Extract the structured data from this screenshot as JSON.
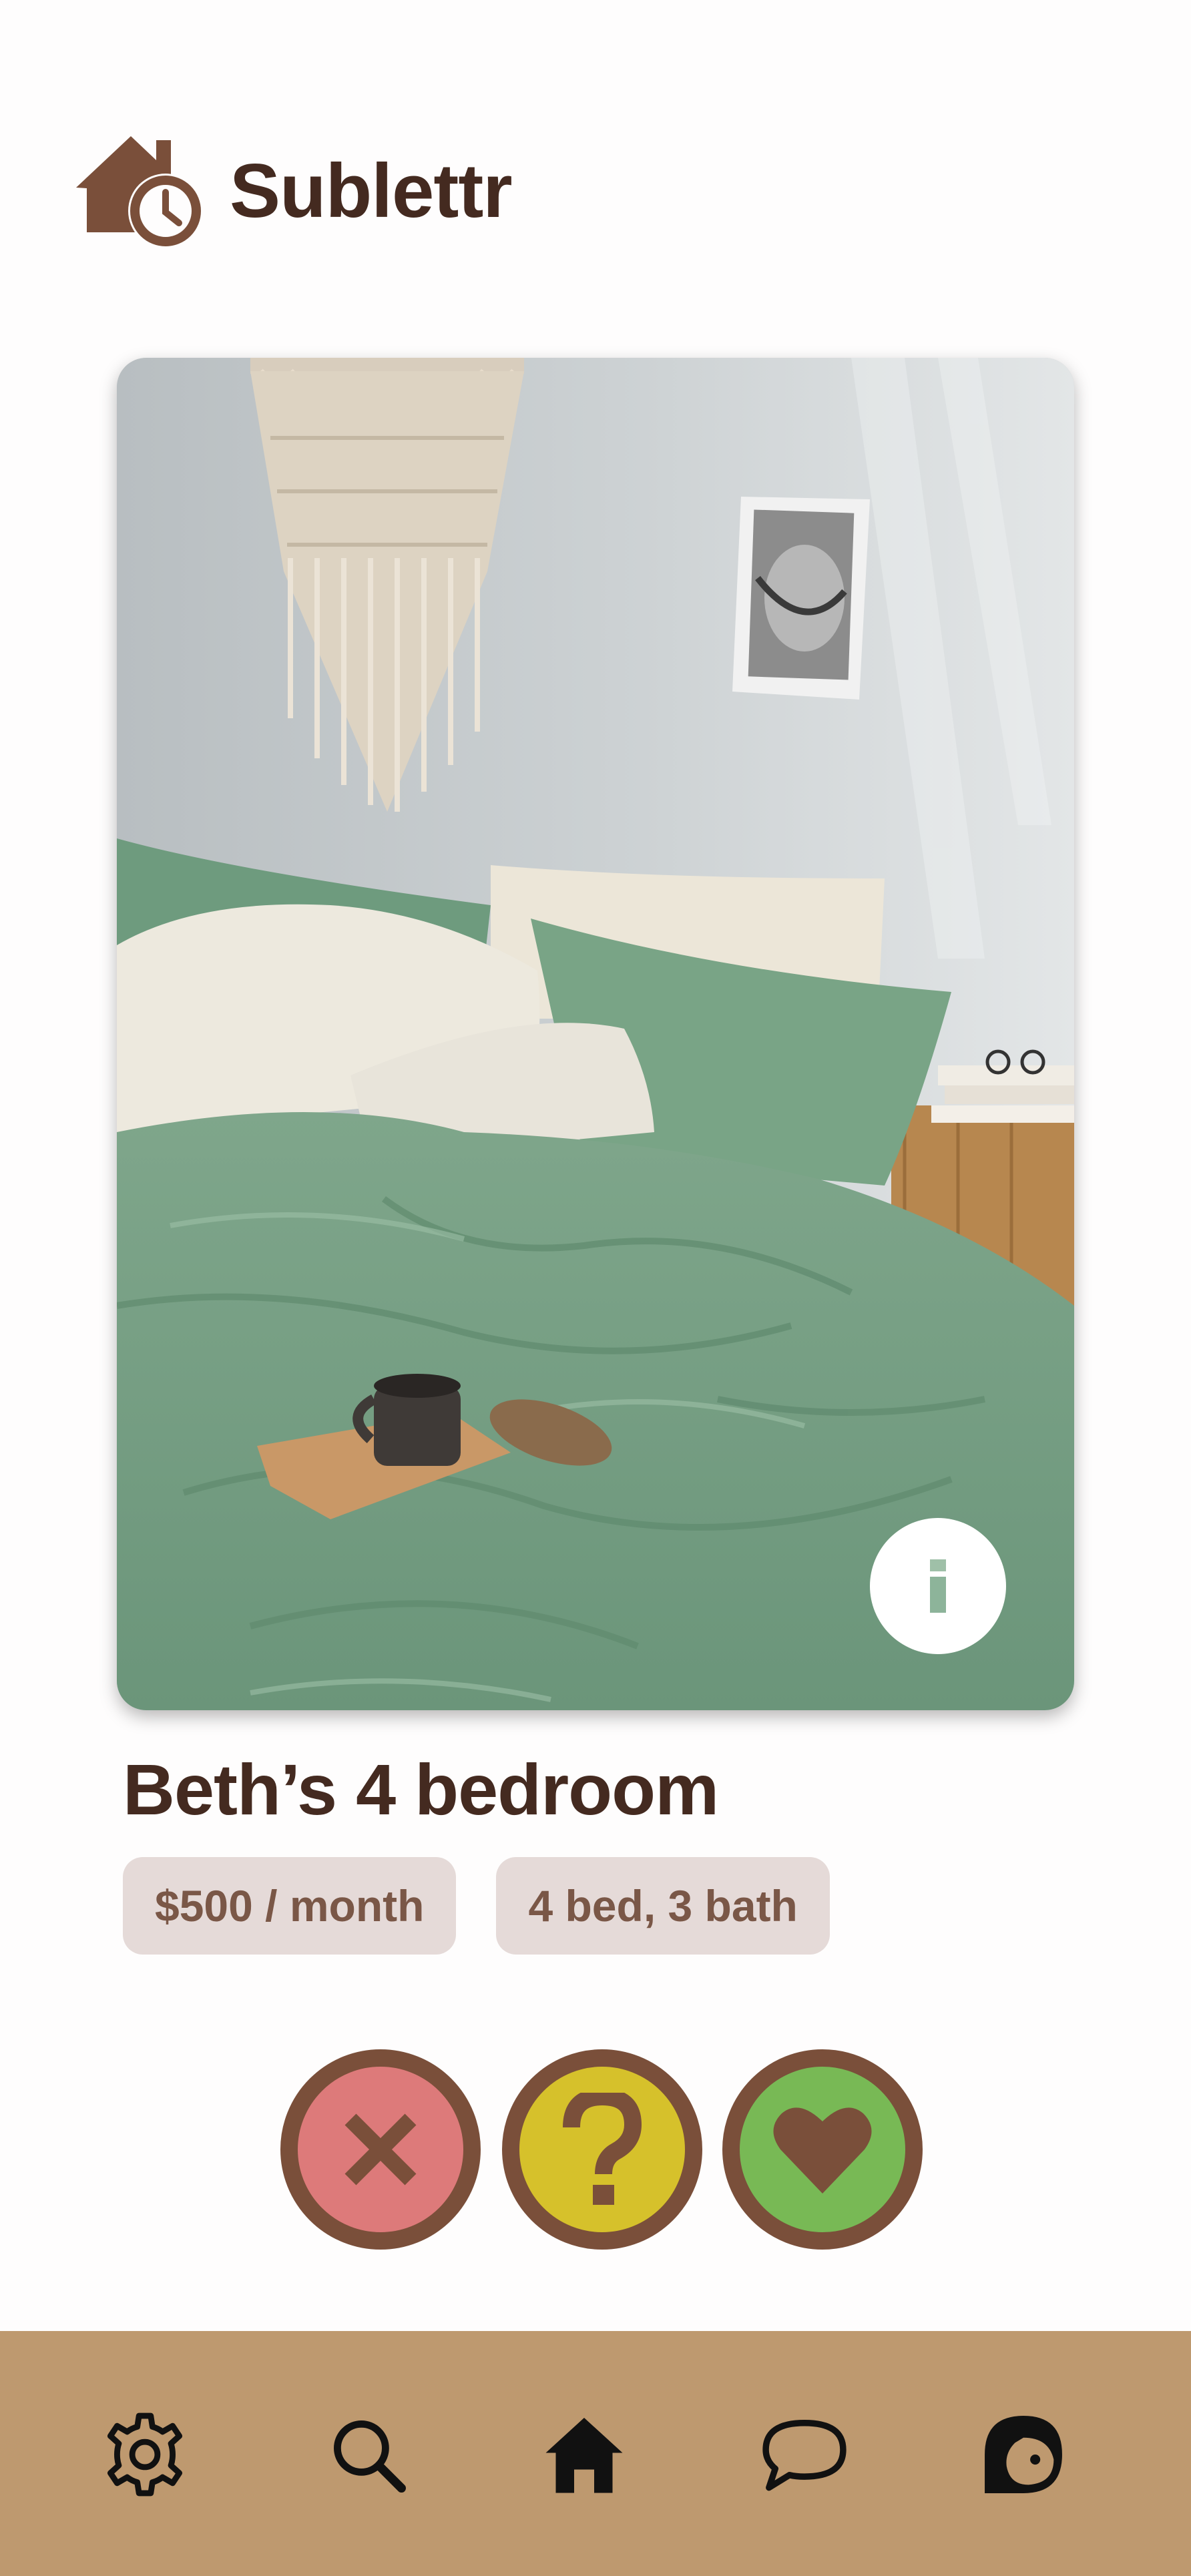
{
  "app": {
    "name": "Sublettr"
  },
  "listing": {
    "title": "Beth’s 4 bedroom",
    "photo": "bedroom with green bedding, macrame wall hanging and wooden nightstand",
    "tags": {
      "price": "$500 / month",
      "rooms": "4 bed, 3 bath"
    }
  },
  "actions": [
    {
      "name": "reject",
      "icon": "x-icon",
      "color": "#dd7a7a"
    },
    {
      "name": "maybe",
      "icon": "question-mark-icon",
      "color": "#d6c12b"
    },
    {
      "name": "like",
      "icon": "heart-icon",
      "color": "#78b955"
    }
  ],
  "nav": {
    "items": [
      "settings-icon",
      "search-icon",
      "home-icon",
      "chat-icon",
      "profile-icon"
    ],
    "background": "#be996f"
  },
  "colors": {
    "brand": "#442a20",
    "accent_brown": "#7a4f3a",
    "tag_bg": "#e5dad8"
  }
}
